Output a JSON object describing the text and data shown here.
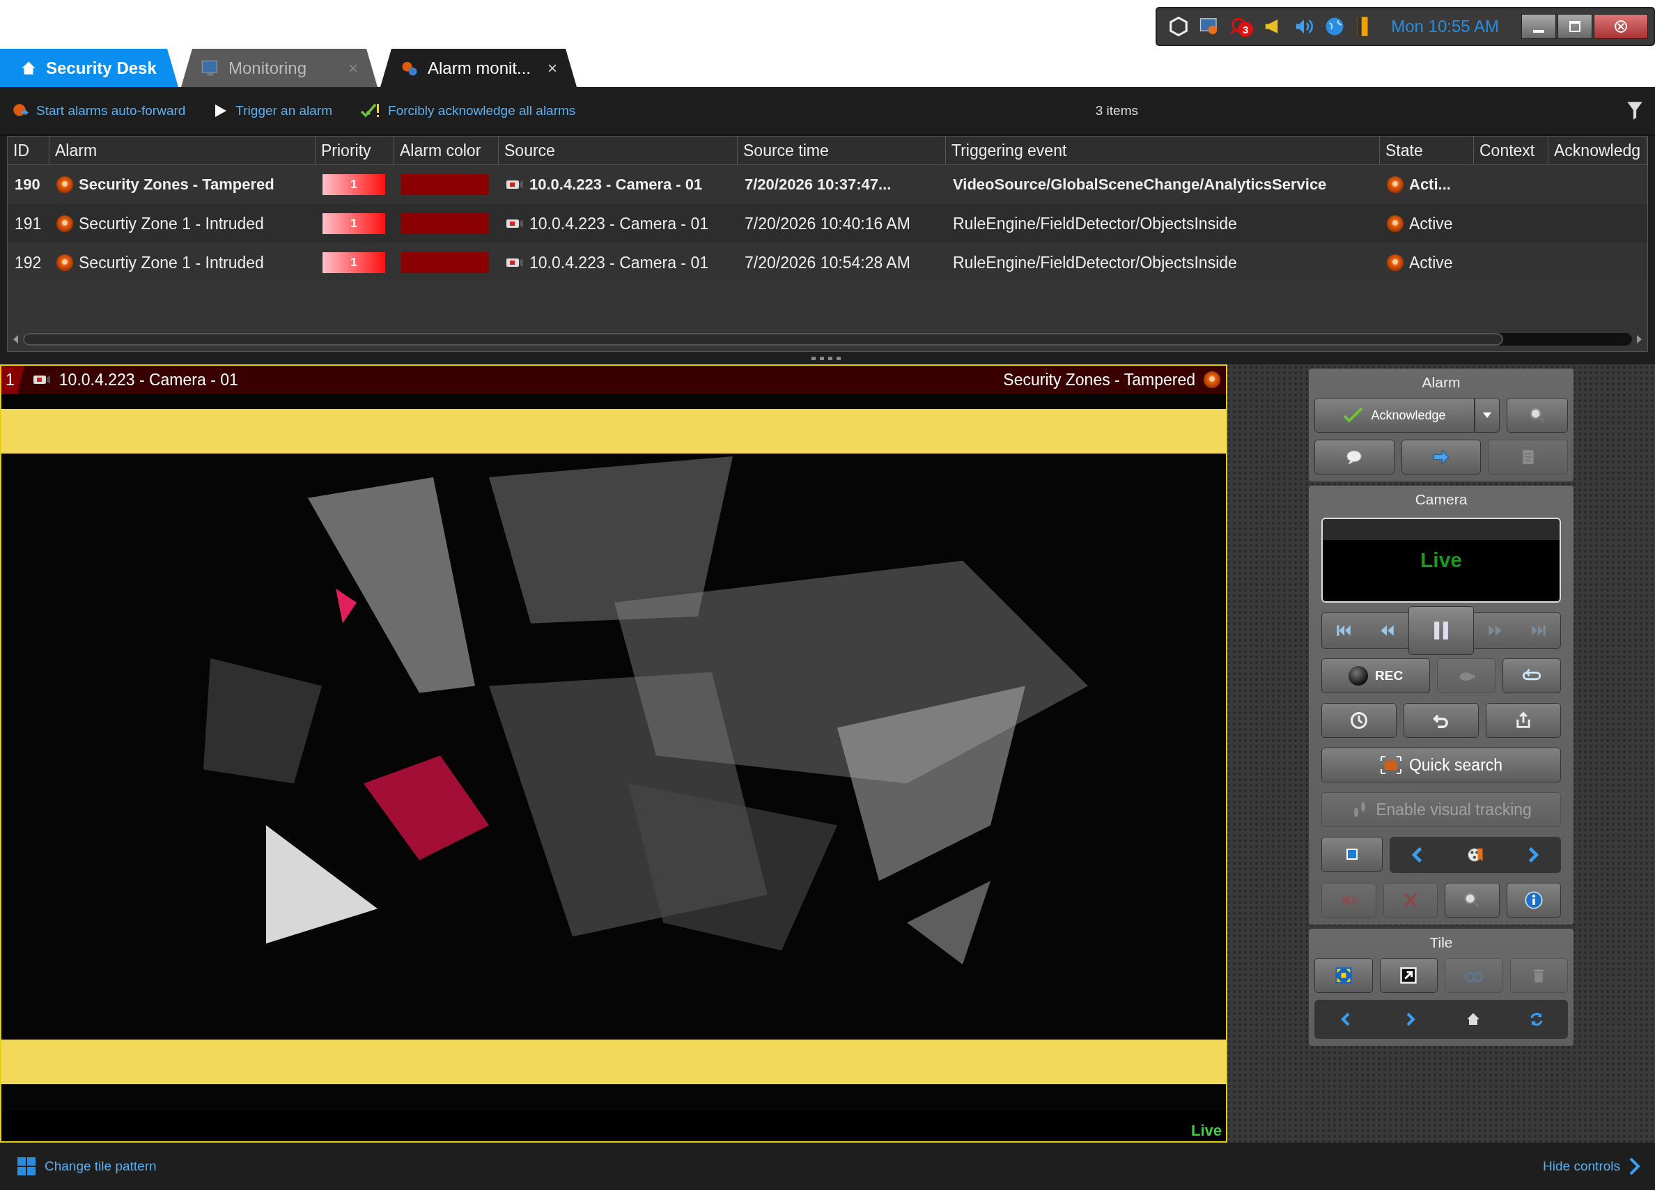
{
  "system_tray": {
    "badge": "3",
    "clock": "Mon 10:55 AM"
  },
  "tabs": [
    {
      "kind": "home",
      "label": "Security Desk",
      "selected": false
    },
    {
      "kind": "task",
      "label": "Monitoring",
      "selected": false,
      "close": "×"
    },
    {
      "kind": "task",
      "label": "Alarm monit...",
      "selected": true,
      "close": "×"
    }
  ],
  "toolbar": {
    "actions": [
      {
        "kind": "forward",
        "label": "Start alarms auto-forward"
      },
      {
        "kind": "trigger",
        "label": "Trigger an alarm"
      },
      {
        "kind": "ack",
        "label": "Forcibly acknowledge all alarms"
      }
    ],
    "count": "3 items"
  },
  "alarm_table": {
    "columns": [
      "ID",
      "Alarm",
      "Priority",
      "Alarm color",
      "Source",
      "Source time",
      "Triggering event",
      "State",
      "Context",
      "Acknowledg"
    ],
    "rows": [
      {
        "id": "190",
        "alarm": "Security Zones - Tampered",
        "priority": "1",
        "color": "#8b0000",
        "source": "10.0.4.223 - Camera - 01",
        "source_time": "7/20/2026 10:37:47...",
        "triggering_event": "VideoSource/GlobalSceneChange/AnalyticsService",
        "state": "Acti...",
        "bold": true
      },
      {
        "id": "191",
        "alarm": "Securtiy Zone 1 - Intruded",
        "priority": "1",
        "color": "#8b0000",
        "source": "10.0.4.223 - Camera - 01",
        "source_time": "7/20/2026 10:40:16 AM",
        "triggering_event": "RuleEngine/FieldDetector/ObjectsInside",
        "state": "Active",
        "bold": false
      },
      {
        "id": "192",
        "alarm": "Securtiy Zone 1 - Intruded",
        "priority": "1",
        "color": "#8b0000",
        "source": "10.0.4.223 - Camera - 01",
        "source_time": "7/20/2026 10:54:28 AM",
        "triggering_event": "RuleEngine/FieldDetector/ObjectsInside",
        "state": "Active",
        "bold": false
      }
    ]
  },
  "tile": {
    "number": "1",
    "source": "10.0.4.223 - Camera - 01",
    "alarm": "Security Zones - Tampered",
    "status": "Live"
  },
  "controls": {
    "alarm": {
      "title": "Alarm",
      "acknowledge": "Acknowledge",
      "buttons": [
        {
          "kind": "search",
          "disabled": false
        },
        {
          "kind": "comment",
          "disabled": false
        },
        {
          "kind": "forward",
          "disabled": false
        },
        {
          "kind": "notes",
          "disabled": true
        }
      ]
    },
    "camera": {
      "title": "Camera",
      "playback": "Live",
      "transport": [
        {
          "kind": "skip-back",
          "disabled": false
        },
        {
          "kind": "rewind",
          "disabled": false
        },
        {
          "kind": "pause",
          "disabled": false
        },
        {
          "kind": "fast-forward",
          "disabled": true
        },
        {
          "kind": "skip-forward",
          "disabled": true
        }
      ],
      "rec": "REC",
      "tools": [
        {
          "kind": "turtle",
          "disabled": true
        },
        {
          "kind": "loop",
          "disabled": false
        },
        {
          "kind": "clock",
          "disabled": false
        },
        {
          "kind": "undo",
          "disabled": false
        },
        {
          "kind": "export",
          "disabled": false
        }
      ],
      "quick_search": "Quick search",
      "visual_tracking": {
        "label": "Enable visual tracking",
        "disabled": true
      },
      "nav": [
        {
          "kind": "snapshot",
          "disabled": false
        },
        {
          "kind": "prev",
          "disabled": false
        },
        {
          "kind": "film",
          "disabled": false
        },
        {
          "kind": "next",
          "disabled": false
        }
      ],
      "actions": [
        {
          "kind": "mute",
          "disabled": true
        },
        {
          "kind": "cut",
          "disabled": true
        },
        {
          "kind": "search",
          "disabled": false
        },
        {
          "kind": "info",
          "disabled": false
        }
      ]
    },
    "tile": {
      "title": "Tile",
      "buttons": [
        {
          "kind": "expand",
          "disabled": false
        },
        {
          "kind": "popout",
          "disabled": false
        },
        {
          "kind": "binoculars",
          "disabled": true
        },
        {
          "kind": "trash",
          "disabled": true
        }
      ],
      "nav": [
        {
          "kind": "prev",
          "disabled": false
        },
        {
          "kind": "next",
          "disabled": false
        },
        {
          "kind": "home",
          "disabled": false
        },
        {
          "kind": "refresh",
          "disabled": false
        }
      ]
    }
  },
  "bottom_bar": {
    "change_tile_pattern": "Change tile pattern",
    "hide_controls": "Hide controls"
  }
}
